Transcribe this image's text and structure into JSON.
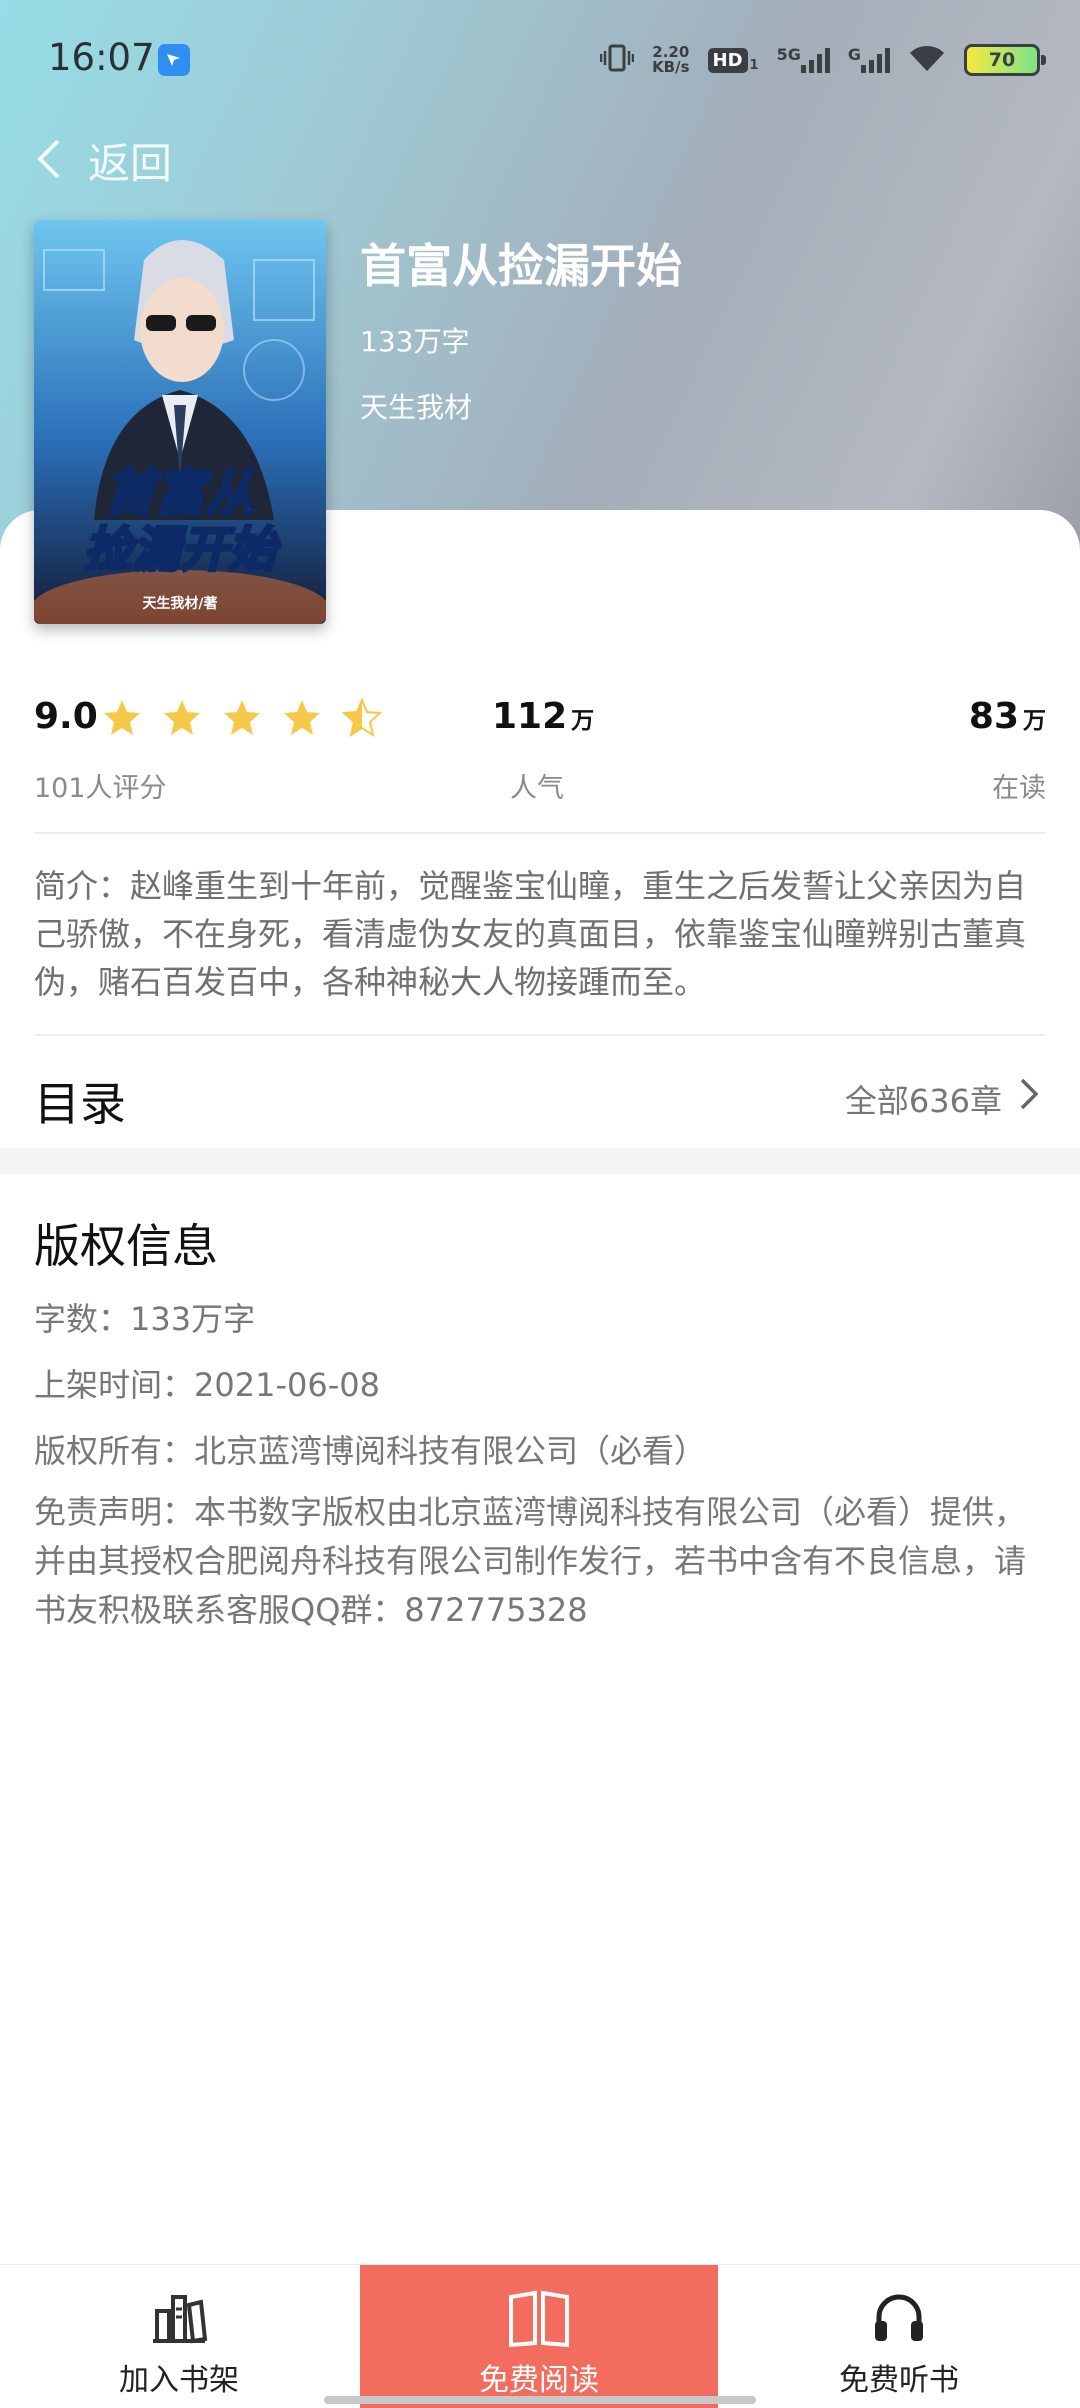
{
  "status_bar": {
    "time": "16:07",
    "net_speed_value": "2.20",
    "net_speed_unit": "KB/s",
    "hd_label": "HD",
    "hd_sub": "1",
    "net_5g": "5G",
    "net_g": "G",
    "battery_level": "70",
    "icons": [
      "app-notification-icon",
      "vibrate-icon",
      "signal-icon",
      "wifi-icon",
      "battery-icon"
    ]
  },
  "nav": {
    "back_label": "返回"
  },
  "book": {
    "title": "首富从捡漏开始",
    "word_count": "133万字",
    "author": "天生我材",
    "cover_title_line1": "首富从",
    "cover_title_line2": "捡漏开始",
    "cover_author": "天生我材/著"
  },
  "stats": {
    "rating": "9.0",
    "rating_stars": 4.5,
    "rating_label": "101人评分",
    "popularity_value": "112",
    "popularity_unit": "万",
    "popularity_label": "人气",
    "reading_value": "83",
    "reading_unit": "万",
    "reading_label": "在读"
  },
  "intro": "简介：赵峰重生到十年前，觉醒鉴宝仙瞳，重生之后发誓让父亲因为自己骄傲，不在身死，看清虚伪女友的真面目，依靠鉴宝仙瞳辨别古董真伪，赌石百发百中，各种神秘大人物接踵而至。",
  "catalog": {
    "title": "目录",
    "count_label": "全部636章"
  },
  "copyright": {
    "title": "版权信息",
    "words": "字数：133万字",
    "publish_date": "上架时间：2021-06-08",
    "owner": "版权所有：北京蓝湾博阅科技有限公司（必看）",
    "disclaimer": "免责声明：本书数字版权由北京蓝湾博阅科技有限公司（必看）提供，并由其授权合肥阅舟科技有限公司制作发行，若书中含有不良信息，请书友积极联系客服QQ群：872775328"
  },
  "tabbar": {
    "bookshelf_label": "加入书架",
    "read_label": "免费阅读",
    "listen_label": "免费听书"
  },
  "colors": {
    "accent": "#f26d5e",
    "star": "#f7c948",
    "header_gradient_start": "#96dde6",
    "header_gradient_end": "#9b9ea6"
  }
}
